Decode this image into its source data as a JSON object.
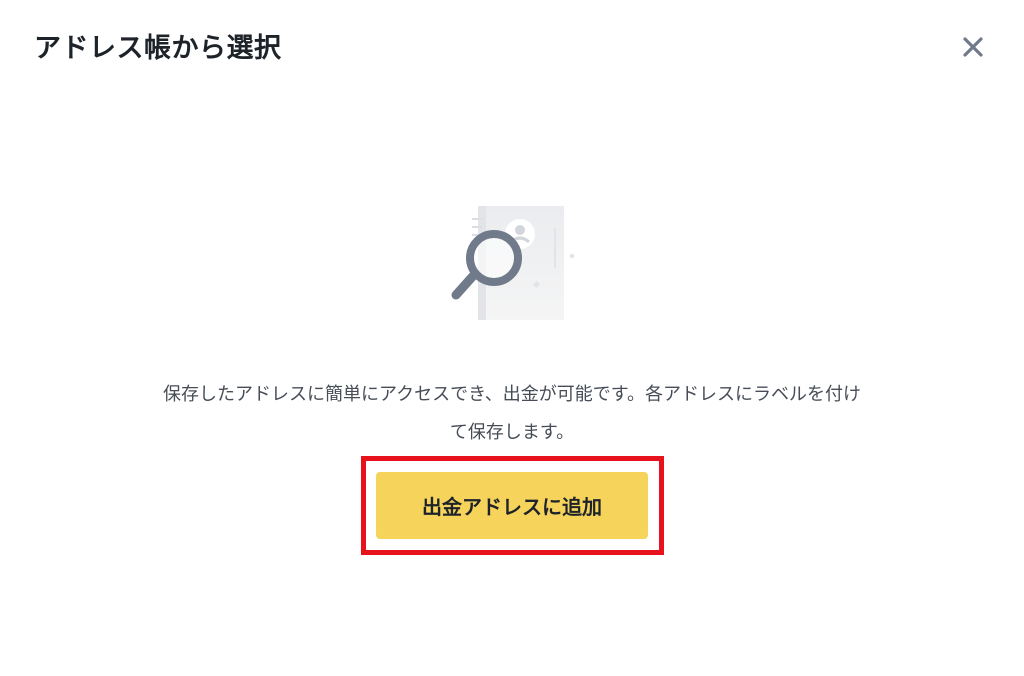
{
  "modal": {
    "title": "アドレス帳から選択",
    "close_icon": "close-icon",
    "illustration_icon": "address-book-search-icon",
    "description": "保存したアドレスに簡単にアクセスでき、出金が可能です。各アドレスにラベルを付けて保存します。",
    "add_button_label": "出金アドレスに追加"
  },
  "colors": {
    "button_bg": "#f6d45c",
    "title_text": "#1e2329",
    "body_text": "#474d57",
    "close_icon": "#707a8a",
    "highlight_frame": "#e8121c"
  }
}
